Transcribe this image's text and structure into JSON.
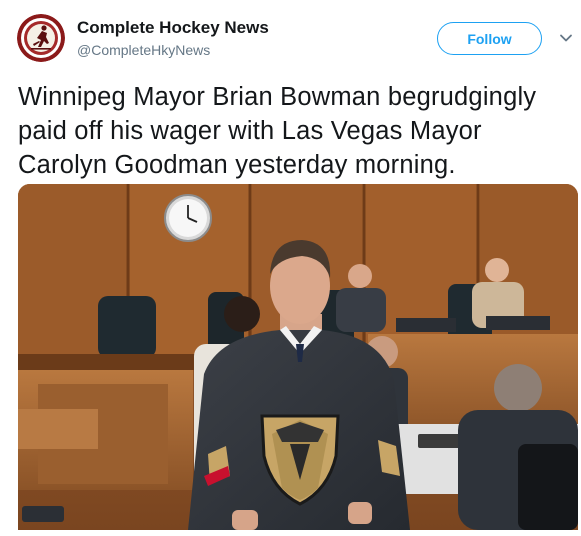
{
  "author": {
    "name": "Complete Hockey News",
    "handle": "@CompleteHkyNews"
  },
  "follow_label": "Follow",
  "tweet": {
    "text_lines": [
      "Winnipeg Mayor Brian Bowman begrudgingly",
      "paid off his wager with Las Vegas Mayor",
      "Carolyn Goodman yesterday morning."
    ]
  },
  "colors": {
    "accent": "#1da1f2",
    "handle_gray": "#657786",
    "text": "#14171a"
  },
  "icons": {
    "avatar": "hockey-logo-icon",
    "menu": "chevron-down-icon"
  }
}
